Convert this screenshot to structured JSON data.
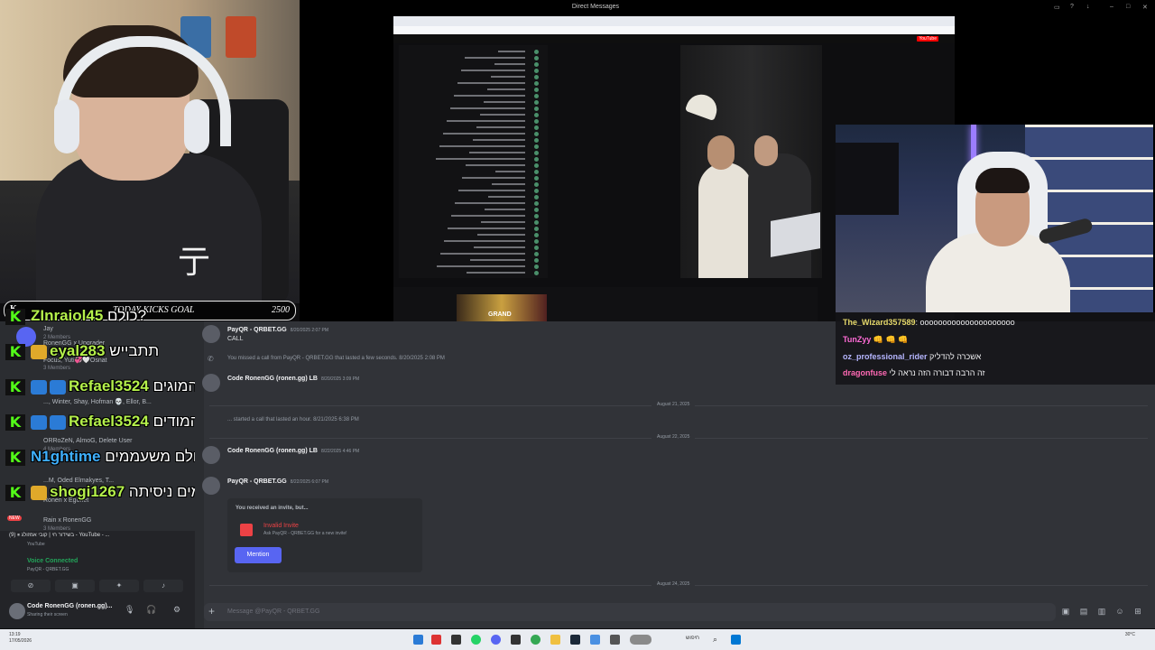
{
  "goal": {
    "icon": "K",
    "title": "TODAY KICKS GOAL",
    "value": "2500"
  },
  "top_bar": {
    "title": "Direct Messages"
  },
  "inner": {
    "youtube": "YouTube",
    "grand": "GRAND"
  },
  "sidebar": {
    "servers": [
      {
        "name": "Jay",
        "members": "2 Members"
      },
      {
        "name": "RonenGG x Upgrader",
        "members": ""
      },
      {
        "name": "Focus, Yuti💞🤍Osnat",
        "members": "3 Members"
      },
      {
        "name": "..., Winter, Shay, Hofman 💀, Ellor, B...",
        "members": ""
      },
      {
        "name": "ORRoZeN, AlmoG, Delete User",
        "members": "4 Members"
      },
      {
        "name": "...M, Oded Elmakyes, T...",
        "members": ""
      },
      {
        "name": "Ronen x Egonet",
        "members": ""
      },
      {
        "name": "Rain x RonenGG",
        "members": "3 Members"
      }
    ],
    "new_badge": "NEW"
  },
  "kick_chat": [
    {
      "user": "ZInraiol45",
      "message": "כולם?"
    },
    {
      "user": "eyal283",
      "message": "תתבייש"
    },
    {
      "user": "Refael3524",
      "message": "לך הפתעה בסוף של המוגים"
    },
    {
      "user": "Refael3524",
      "message": "לך הפתעה בסוף של המודים"
    },
    {
      "user": "N1ghtime",
      "message": "אין עוד דברים לעשות כולם משעממים"
    },
    {
      "user": "shogi1267",
      "message": "מבטיח זה אחד הטעמים ניסיתה"
    }
  ],
  "voice": {
    "youtube_tab": "(9) ⏸ בשידור חי | קובי אמזולג - YouTube - ...",
    "youtube_sub": "YouTube",
    "connected": "Voice Connected",
    "channel": "PayQR - QRBET.GG",
    "user": "Code RonenGG (ronen.gg)...",
    "status": "Sharing their screen"
  },
  "messages": [
    {
      "name": "PayQR - QRBET.GG",
      "time": "8/20/2025 2:07 PM",
      "text": "CALL"
    },
    {
      "system": "You missed a call from PayQR - QRBET.GG that lasted a few seconds.",
      "time": "8/20/2025 2:08 PM"
    },
    {
      "name": "Code RonenGG (ronen.gg) LB",
      "time": "8/20/2025 3:09 PM",
      "text": ""
    },
    {
      "system": "... started a call that lasted an hour.",
      "time": "8/21/2025 6:38 PM"
    },
    {
      "name": "Code RonenGG (ronen.gg) LB",
      "time": "8/22/2025 4:46 PM",
      "text": ""
    },
    {
      "name": "PayQR - QRBET.GG",
      "time": "8/22/2025 6:07 PM",
      "text": ""
    }
  ],
  "dates": [
    "August 21, 2025",
    "August 22, 2025",
    "August 24, 2025"
  ],
  "invite": {
    "header": "You received an invite, but...",
    "title": "Invalid Invite",
    "sub": "Ask PayQR - QRBET.GG for a new invite!",
    "button": "Mention"
  },
  "composer": {
    "placeholder": "Message @PayQR - QRBET.GG"
  },
  "twitch_chat": [
    {
      "user": "The_Wizard357589",
      "message": "ooooooooooooooooooooo",
      "color": "#e6d96b"
    },
    {
      "user": "TunZyy",
      "message": "👊 👊 👊",
      "color": "#ff6bd6"
    },
    {
      "user": "oz_professional_rider",
      "message": "אשכרה להדליק",
      "color": "#b6b6ff"
    },
    {
      "user": "dragonfuse",
      "message": "זה הרבה דבורה הזה נראה לי",
      "color": "#ff69b4"
    }
  ],
  "taskbar": {
    "time_left": "13:19",
    "date_left": "17/05/2026",
    "time_right": "30°C",
    "search": "חיפוש"
  },
  "colors": {
    "kick_green": "#53fc18",
    "discord_blurple": "#5865f2"
  }
}
